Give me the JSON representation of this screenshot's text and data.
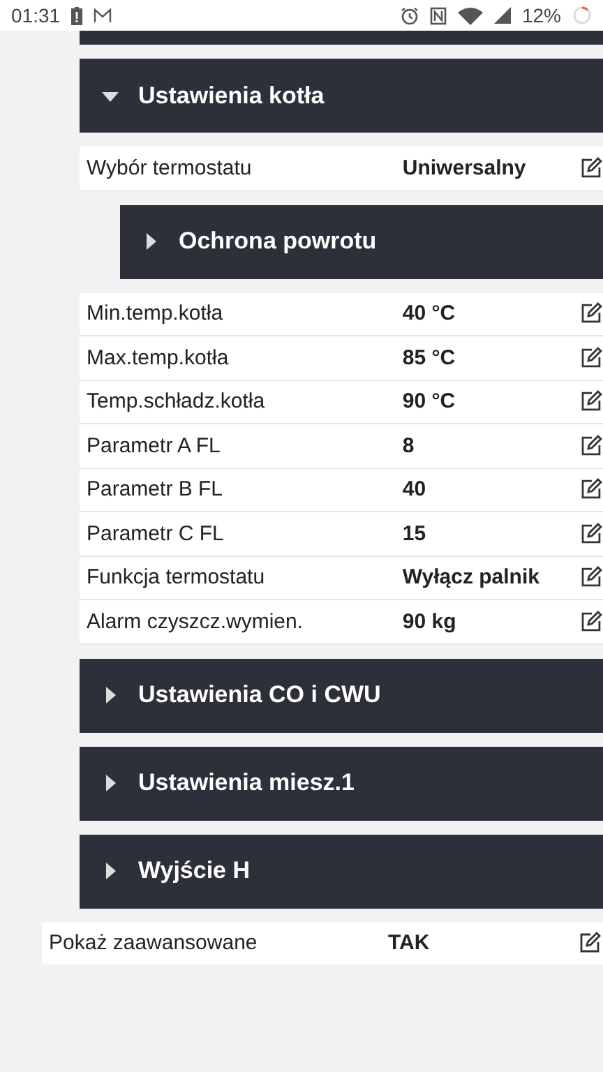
{
  "status_bar": {
    "time": "01:31",
    "battery": "12%"
  },
  "sections": [
    {
      "title": "Ustawienia kotła",
      "expanded": true,
      "items": [
        {
          "kind": "row",
          "label": "Wybór termostatu",
          "value": "Uniwersalny"
        },
        {
          "kind": "section",
          "title": "Ochrona powrotu",
          "expanded": false
        },
        {
          "kind": "row",
          "label": "Min.temp.kotła",
          "value": "40 °C"
        },
        {
          "kind": "row",
          "label": "Max.temp.kotła",
          "value": "85 °C"
        },
        {
          "kind": "row",
          "label": "Temp.schładz.kotła",
          "value": "90 °C"
        },
        {
          "kind": "row",
          "label": "Parametr A FL",
          "value": "8"
        },
        {
          "kind": "row",
          "label": "Parametr B FL",
          "value": "40"
        },
        {
          "kind": "row",
          "label": "Parametr C FL",
          "value": "15"
        },
        {
          "kind": "row",
          "label": "Funkcja termostatu",
          "value": "Wyłącz palnik"
        },
        {
          "kind": "row",
          "label": "Alarm czyszcz.wymien.",
          "value": "90 kg"
        }
      ]
    },
    {
      "title": "Ustawienia CO i CWU",
      "expanded": false
    },
    {
      "title": "Ustawienia miesz.1",
      "expanded": false
    },
    {
      "title": "Wyjście H",
      "expanded": false
    }
  ],
  "advanced": {
    "label": "Pokaż zaawansowane",
    "value": "TAK"
  }
}
